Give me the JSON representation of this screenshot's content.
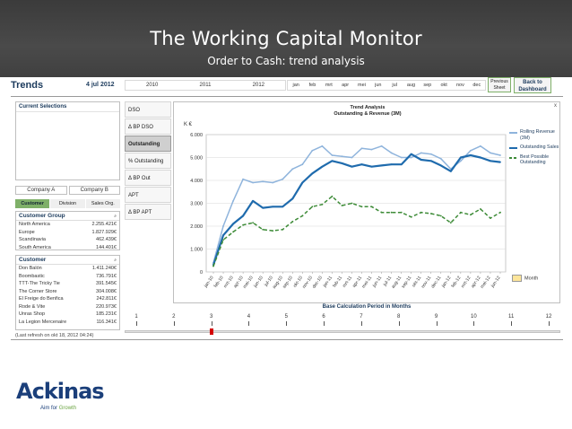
{
  "banner": {
    "title": "The Working Capital Monitor",
    "subtitle": "Order to Cash: trend analysis"
  },
  "topbar": {
    "title": "Trends",
    "date": "4 jul 2012",
    "years": [
      "2010",
      "2011",
      "2012"
    ],
    "months": [
      "jan",
      "feb",
      "mrt",
      "apr",
      "mei",
      "jun",
      "jul",
      "aug",
      "sep",
      "okt",
      "nov",
      "dec"
    ],
    "previous_label": "Previous Sheet",
    "back_label": "Back to Dashboard"
  },
  "left": {
    "current_selections_title": "Current Selections",
    "company_a": "Company A",
    "company_b": "Company B",
    "tabs": [
      "Customer",
      "Division",
      "Sales Org."
    ],
    "customer_group": {
      "title": "Customer Group",
      "rows": [
        {
          "name": "North America",
          "value": "2.255.421€"
        },
        {
          "name": "Europe",
          "value": "1.827.929€"
        },
        {
          "name": "Scandinavia",
          "value": "462.439€"
        },
        {
          "name": "South America",
          "value": "144.401€"
        }
      ]
    },
    "customer": {
      "title": "Customer",
      "rows": [
        {
          "name": "Don Balón",
          "value": "1.411.240€"
        },
        {
          "name": "Boombastic",
          "value": "736.791€"
        },
        {
          "name": "TTT-The Tricky Tie",
          "value": "391.545€"
        },
        {
          "name": "The Corner Store",
          "value": "304.008€"
        },
        {
          "name": "El Freige do Benfica",
          "value": "242.811€"
        },
        {
          "name": "Rode & Vite",
          "value": "220.973€"
        },
        {
          "name": "Unras Shop",
          "value": "185.231€"
        },
        {
          "name": "La Legion Mercenaire",
          "value": "116.341€"
        }
      ]
    },
    "refresh": "(Last refresh on okt 18, 2012 04:24)"
  },
  "kpis": [
    "DSO",
    "Δ BP DSO",
    "Outstanding",
    "% Outstanding",
    "Δ BP Out",
    "APT",
    "Δ BP APT"
  ],
  "kpi_active": "Outstanding",
  "chart_labels": {
    "close": "x",
    "month_toggle": "Month"
  },
  "chart_data": {
    "type": "line",
    "title": "Trend Analysis",
    "subtitle": "Outstanding & Revenue (3M)",
    "ylabel": "K €",
    "ylim": [
      0,
      6000
    ],
    "yticks": [
      0,
      1000,
      2000,
      3000,
      4000,
      5000,
      6000
    ],
    "ytick_labels": [
      "0",
      "1.000",
      "2.000",
      "3.000",
      "4.000",
      "5.000",
      "6.000"
    ],
    "grid": true,
    "legend_position": "right",
    "x": [
      "jan-10",
      "feb-10",
      "mrt-10",
      "apr-10",
      "mei-10",
      "jun-10",
      "jul-10",
      "aug-10",
      "sep-10",
      "okt-10",
      "nov-10",
      "dec-10",
      "jan-11",
      "feb-11",
      "mrt-11",
      "apr-11",
      "mei-11",
      "jun-11",
      "jul-11",
      "aug-11",
      "sep-11",
      "okt-11",
      "nov-11",
      "dec-11",
      "jan-12",
      "feb-12",
      "mrt-12",
      "apr-12",
      "mei-12",
      "jun-12"
    ],
    "series": [
      {
        "name": "Rolling Revenue (3M)",
        "color": "#8fb4dc",
        "style": "solid",
        "values": [
          400,
          2000,
          3100,
          4050,
          3900,
          3950,
          3900,
          4050,
          4500,
          4700,
          5300,
          5500,
          5100,
          5050,
          5000,
          5400,
          5350,
          5500,
          5200,
          5000,
          5000,
          5200,
          5150,
          4950,
          4500,
          4850,
          5300,
          5500,
          5200,
          5100
        ]
      },
      {
        "name": "Outstanding Sales",
        "color": "#1f6bad",
        "style": "solid",
        "values": [
          300,
          1600,
          2100,
          2450,
          3100,
          2800,
          2850,
          2850,
          3200,
          3900,
          4300,
          4600,
          4850,
          4750,
          4600,
          4700,
          4600,
          4650,
          4700,
          4700,
          5150,
          4900,
          4850,
          4650,
          4400,
          5000,
          5100,
          5000,
          4850,
          4800
        ]
      },
      {
        "name": "Best Possible Outstanding",
        "color": "#3d8b37",
        "style": "dashed",
        "values": [
          250,
          1400,
          1750,
          2050,
          2150,
          1850,
          1800,
          1850,
          2200,
          2450,
          2850,
          2950,
          3300,
          2900,
          3000,
          2850,
          2850,
          2600,
          2600,
          2600,
          2400,
          2600,
          2550,
          2450,
          2150,
          2600,
          2500,
          2750,
          2350,
          2600
        ]
      }
    ]
  },
  "slider": {
    "title": "Base Calculation Period in Months",
    "ticks": [
      "1",
      "2",
      "3",
      "4",
      "5",
      "6",
      "7",
      "8",
      "9",
      "10",
      "11",
      "12"
    ],
    "value": 3
  },
  "logo": {
    "name": "Ackinas",
    "tag_prefix": "Aim for",
    "tag_highlight": "Growth"
  }
}
